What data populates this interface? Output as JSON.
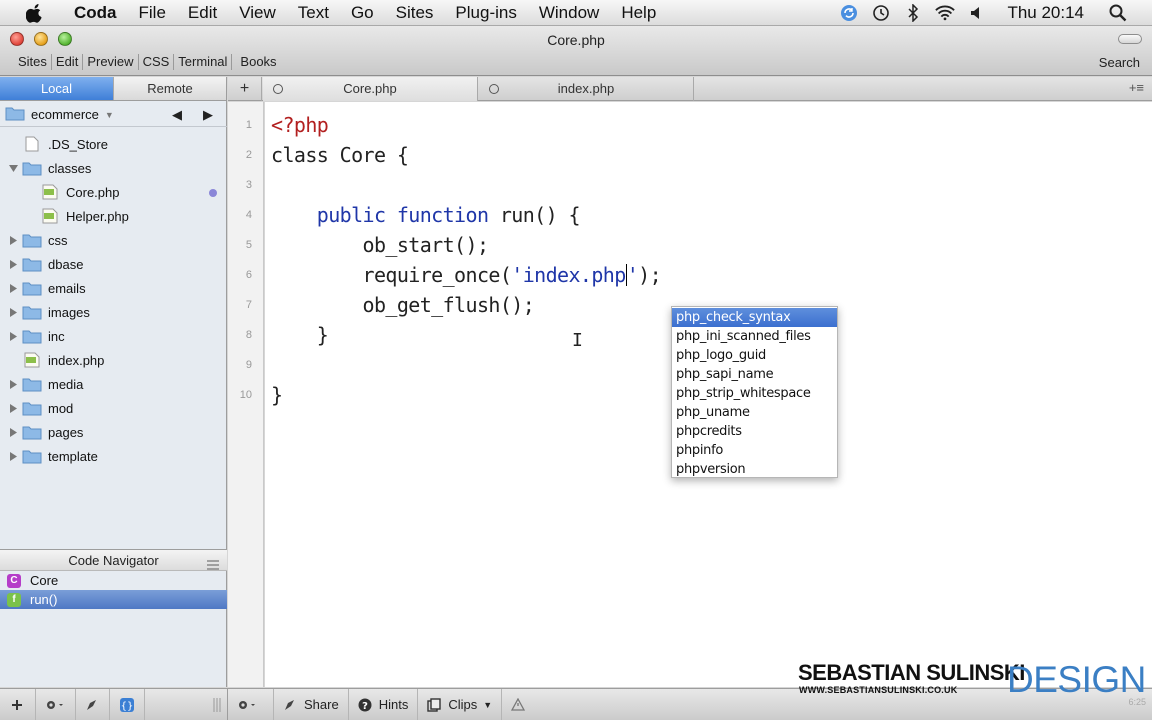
{
  "menubar": {
    "app": "Coda",
    "items": [
      "File",
      "Edit",
      "View",
      "Text",
      "Go",
      "Sites",
      "Plug-ins",
      "Window",
      "Help"
    ],
    "clock": "Thu 20:14"
  },
  "window": {
    "title": "Core.php",
    "toolbar": [
      "Sites",
      "Edit",
      "Preview",
      "CSS",
      "Terminal",
      "Books"
    ],
    "search": "Search"
  },
  "sidebar": {
    "tabs": [
      "Local",
      "Remote"
    ],
    "site": "ecommerce",
    "tree": [
      {
        "name": ".DS_Store",
        "type": "file",
        "level": 1
      },
      {
        "name": "classes",
        "type": "folder-open",
        "level": 1
      },
      {
        "name": "Core.php",
        "type": "php",
        "level": 2,
        "modified": true
      },
      {
        "name": "Helper.php",
        "type": "php",
        "level": 2
      },
      {
        "name": "css",
        "type": "folder",
        "level": 1
      },
      {
        "name": "dbase",
        "type": "folder",
        "level": 1
      },
      {
        "name": "emails",
        "type": "folder",
        "level": 1
      },
      {
        "name": "images",
        "type": "folder",
        "level": 1
      },
      {
        "name": "inc",
        "type": "folder",
        "level": 1
      },
      {
        "name": "index.php",
        "type": "php",
        "level": 1
      },
      {
        "name": "media",
        "type": "folder",
        "level": 1
      },
      {
        "name": "mod",
        "type": "folder",
        "level": 1
      },
      {
        "name": "pages",
        "type": "folder",
        "level": 1
      },
      {
        "name": "template",
        "type": "folder",
        "level": 1
      }
    ],
    "code_navigator": {
      "title": "Code Navigator",
      "items": [
        {
          "badge": "C",
          "label": "Core",
          "color": "#b53dc9"
        },
        {
          "badge": "f",
          "label": "run()",
          "color": "#7bc24a",
          "selected": true
        }
      ]
    }
  },
  "editor": {
    "tabs": [
      "Core.php",
      "index.php"
    ],
    "lines": [
      {
        "n": "1",
        "parts": [
          {
            "t": "<?php",
            "c": "tag"
          }
        ]
      },
      {
        "n": "2",
        "parts": [
          {
            "t": "class Core {",
            "c": ""
          }
        ]
      },
      {
        "n": "3",
        "parts": []
      },
      {
        "n": "4",
        "parts": [
          {
            "t": "    ",
            "c": ""
          },
          {
            "t": "public function",
            "c": "kw"
          },
          {
            "t": " run() {",
            "c": ""
          }
        ]
      },
      {
        "n": "5",
        "parts": [
          {
            "t": "        ob_start();",
            "c": ""
          }
        ]
      },
      {
        "n": "6",
        "parts": [
          {
            "t": "        require_once(",
            "c": ""
          },
          {
            "t": "'index.php",
            "c": "str"
          },
          {
            "t": "|",
            "c": "caret"
          },
          {
            "t": "'",
            "c": "str"
          },
          {
            "t": ");",
            "c": ""
          }
        ]
      },
      {
        "n": "7",
        "parts": [
          {
            "t": "        ob_get_flush();",
            "c": ""
          }
        ]
      },
      {
        "n": "8",
        "parts": [
          {
            "t": "    }",
            "c": ""
          }
        ]
      },
      {
        "n": "9",
        "parts": []
      },
      {
        "n": "10",
        "parts": [
          {
            "t": "}",
            "c": ""
          }
        ]
      }
    ],
    "autocomplete": [
      "php_check_syntax",
      "php_ini_scanned_files",
      "php_logo_guid",
      "php_sapi_name",
      "php_strip_whitespace",
      "php_uname",
      "phpcredits",
      "phpinfo",
      "phpversion"
    ],
    "autocomplete_selected": 0
  },
  "bottombar": {
    "share": "Share",
    "hints": "Hints",
    "clips": "Clips"
  },
  "watermark": {
    "name": "SEBASTIAN SULINSKI",
    "url": "WWW.SEBASTIANSULINSKI.CO.UK",
    "design": "DESIGN",
    "timecode": "6:25"
  }
}
